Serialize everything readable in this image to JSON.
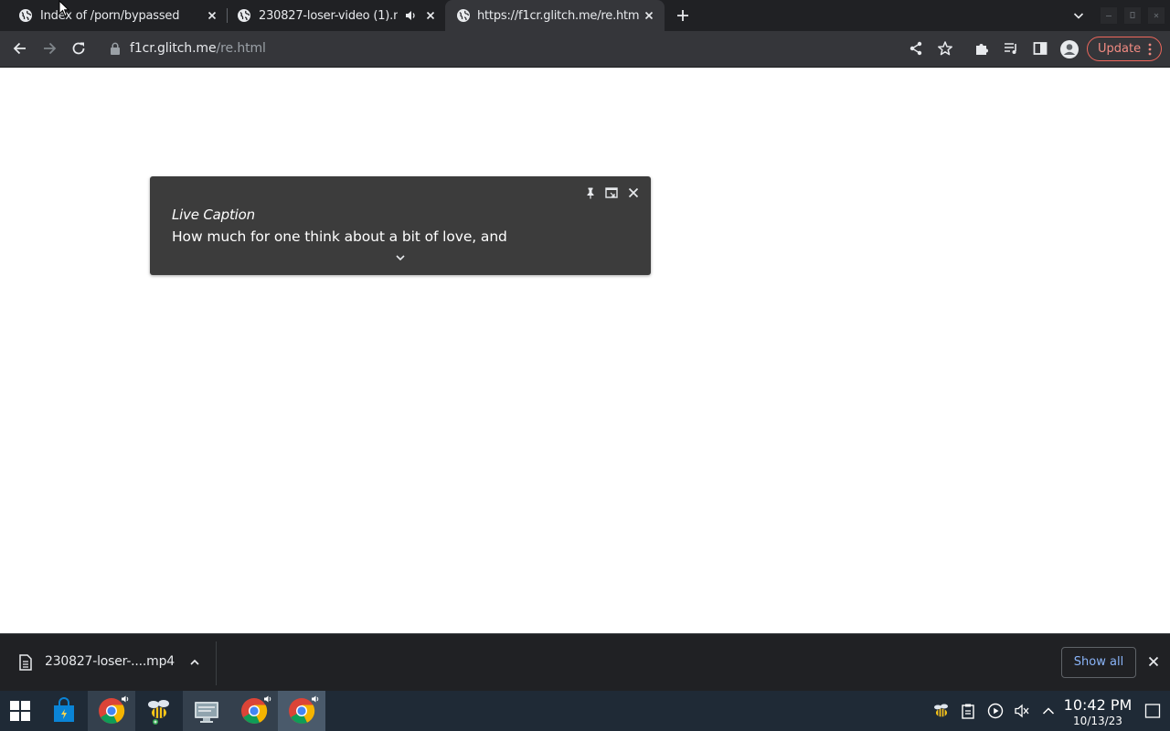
{
  "tabs": [
    {
      "title": "Index of /porn/bypassed",
      "active": false
    },
    {
      "title": "230827-loser-video (1).mp4",
      "active": false,
      "audio": true
    },
    {
      "title": "https://f1cr.glitch.me/re.html",
      "active": true
    }
  ],
  "toolbar": {
    "url_host": "f1cr.glitch.me",
    "url_path": "/re.html",
    "update_label": "Update"
  },
  "live_caption": {
    "title": "Live Caption",
    "text": "How much for one think about a bit of love, and"
  },
  "download_shelf": {
    "file_name": "230827-loser-....mp4",
    "show_all_label": "Show all"
  },
  "taskbar": {
    "time": "10:42 PM",
    "date": "10/13/23"
  },
  "colors": {
    "tabstrip_bg": "#202124",
    "toolbar_bg": "#35363a",
    "caption_bg": "#3c3c3c",
    "update_accent": "#f28b82",
    "link_blue": "#8ab4f8",
    "taskbar_bg": "#1f2a36"
  }
}
